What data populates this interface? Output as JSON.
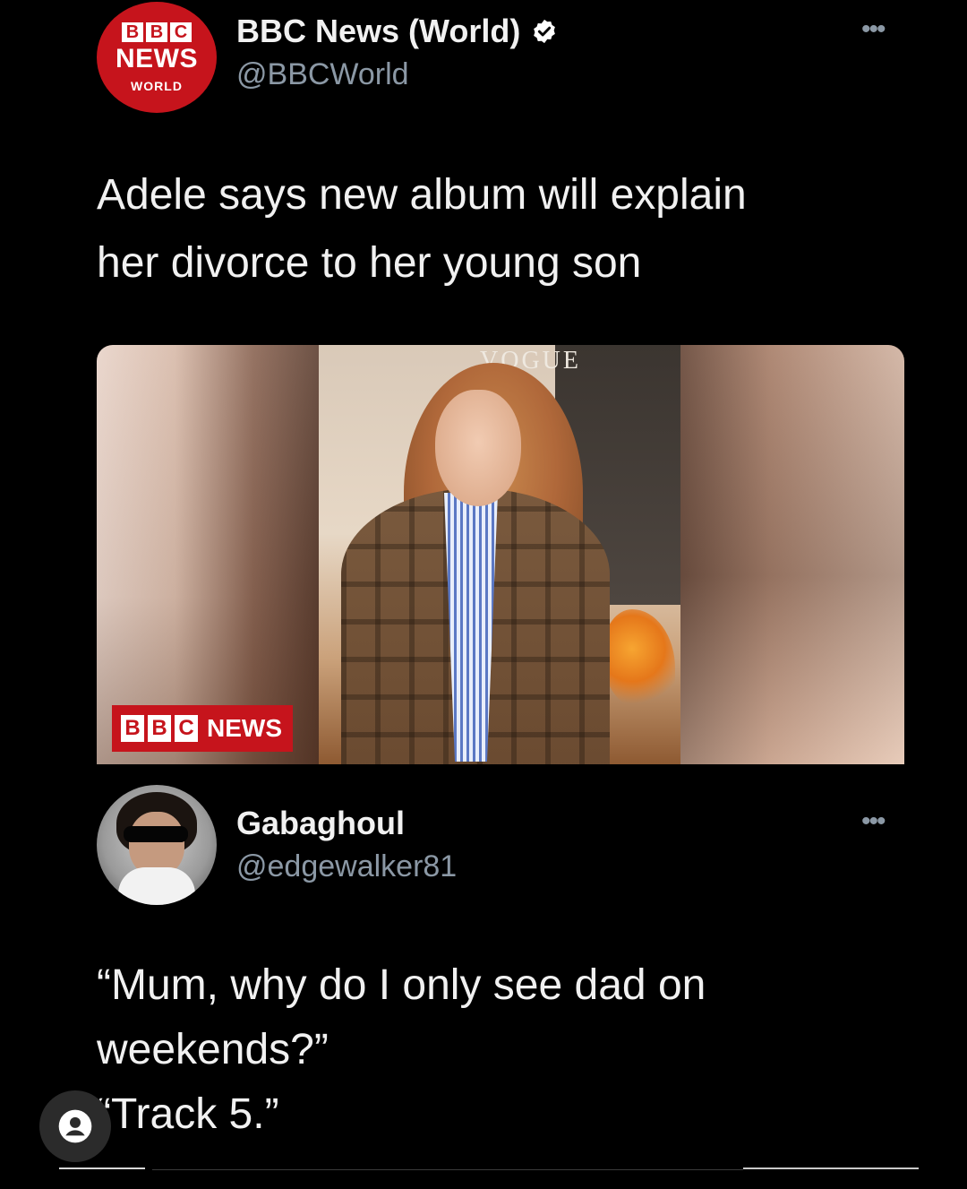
{
  "tweet_1": {
    "avatar": {
      "blocks": [
        "B",
        "B",
        "C"
      ],
      "line_1": "NEWS",
      "line_2": "WORLD"
    },
    "display_name": "BBC News (World)",
    "verified": true,
    "handle": "@BBCWorld",
    "more_icon": "more-horizontal-icon",
    "text_lines": [
      "Adele says new album will explain",
      "her divorce to her young son"
    ],
    "media": {
      "masthead": "VOGUE",
      "watermark_blocks": [
        "B",
        "B",
        "C"
      ],
      "watermark_word": "NEWS"
    }
  },
  "tweet_2": {
    "display_name": "Gabaghoul",
    "handle": "@edgewalker81",
    "more_icon": "more-horizontal-icon",
    "text_lines": [
      "“Mum, why do I only see dad on",
      "weekends?”",
      "“Track 5.”"
    ]
  },
  "colors": {
    "background": "#000000",
    "bbc_red": "#c6141c",
    "verified_badge": "#ffffff",
    "secondary_text": "#8b98a5"
  },
  "overlay": {
    "profile_button_icon": "user-circle-icon"
  }
}
